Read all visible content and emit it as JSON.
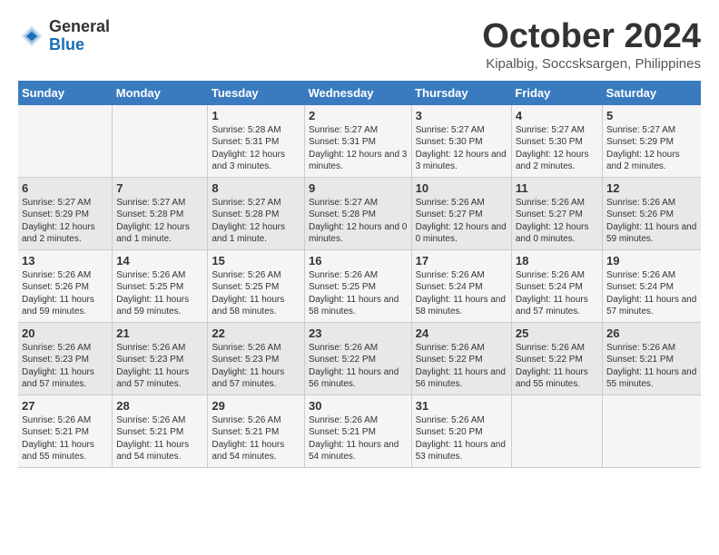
{
  "header": {
    "logo_line1": "General",
    "logo_line2": "Blue",
    "month_title": "October 2024",
    "location": "Kipalbig, Soccsksargen, Philippines"
  },
  "days_of_week": [
    "Sunday",
    "Monday",
    "Tuesday",
    "Wednesday",
    "Thursday",
    "Friday",
    "Saturday"
  ],
  "weeks": [
    [
      {
        "day": "",
        "text": ""
      },
      {
        "day": "",
        "text": ""
      },
      {
        "day": "1",
        "text": "Sunrise: 5:28 AM\nSunset: 5:31 PM\nDaylight: 12 hours and 3 minutes."
      },
      {
        "day": "2",
        "text": "Sunrise: 5:27 AM\nSunset: 5:31 PM\nDaylight: 12 hours and 3 minutes."
      },
      {
        "day": "3",
        "text": "Sunrise: 5:27 AM\nSunset: 5:30 PM\nDaylight: 12 hours and 3 minutes."
      },
      {
        "day": "4",
        "text": "Sunrise: 5:27 AM\nSunset: 5:30 PM\nDaylight: 12 hours and 2 minutes."
      },
      {
        "day": "5",
        "text": "Sunrise: 5:27 AM\nSunset: 5:29 PM\nDaylight: 12 hours and 2 minutes."
      }
    ],
    [
      {
        "day": "6",
        "text": "Sunrise: 5:27 AM\nSunset: 5:29 PM\nDaylight: 12 hours and 2 minutes."
      },
      {
        "day": "7",
        "text": "Sunrise: 5:27 AM\nSunset: 5:28 PM\nDaylight: 12 hours and 1 minute."
      },
      {
        "day": "8",
        "text": "Sunrise: 5:27 AM\nSunset: 5:28 PM\nDaylight: 12 hours and 1 minute."
      },
      {
        "day": "9",
        "text": "Sunrise: 5:27 AM\nSunset: 5:28 PM\nDaylight: 12 hours and 0 minutes."
      },
      {
        "day": "10",
        "text": "Sunrise: 5:26 AM\nSunset: 5:27 PM\nDaylight: 12 hours and 0 minutes."
      },
      {
        "day": "11",
        "text": "Sunrise: 5:26 AM\nSunset: 5:27 PM\nDaylight: 12 hours and 0 minutes."
      },
      {
        "day": "12",
        "text": "Sunrise: 5:26 AM\nSunset: 5:26 PM\nDaylight: 11 hours and 59 minutes."
      }
    ],
    [
      {
        "day": "13",
        "text": "Sunrise: 5:26 AM\nSunset: 5:26 PM\nDaylight: 11 hours and 59 minutes."
      },
      {
        "day": "14",
        "text": "Sunrise: 5:26 AM\nSunset: 5:25 PM\nDaylight: 11 hours and 59 minutes."
      },
      {
        "day": "15",
        "text": "Sunrise: 5:26 AM\nSunset: 5:25 PM\nDaylight: 11 hours and 58 minutes."
      },
      {
        "day": "16",
        "text": "Sunrise: 5:26 AM\nSunset: 5:25 PM\nDaylight: 11 hours and 58 minutes."
      },
      {
        "day": "17",
        "text": "Sunrise: 5:26 AM\nSunset: 5:24 PM\nDaylight: 11 hours and 58 minutes."
      },
      {
        "day": "18",
        "text": "Sunrise: 5:26 AM\nSunset: 5:24 PM\nDaylight: 11 hours and 57 minutes."
      },
      {
        "day": "19",
        "text": "Sunrise: 5:26 AM\nSunset: 5:24 PM\nDaylight: 11 hours and 57 minutes."
      }
    ],
    [
      {
        "day": "20",
        "text": "Sunrise: 5:26 AM\nSunset: 5:23 PM\nDaylight: 11 hours and 57 minutes."
      },
      {
        "day": "21",
        "text": "Sunrise: 5:26 AM\nSunset: 5:23 PM\nDaylight: 11 hours and 57 minutes."
      },
      {
        "day": "22",
        "text": "Sunrise: 5:26 AM\nSunset: 5:23 PM\nDaylight: 11 hours and 57 minutes."
      },
      {
        "day": "23",
        "text": "Sunrise: 5:26 AM\nSunset: 5:22 PM\nDaylight: 11 hours and 56 minutes."
      },
      {
        "day": "24",
        "text": "Sunrise: 5:26 AM\nSunset: 5:22 PM\nDaylight: 11 hours and 56 minutes."
      },
      {
        "day": "25",
        "text": "Sunrise: 5:26 AM\nSunset: 5:22 PM\nDaylight: 11 hours and 55 minutes."
      },
      {
        "day": "26",
        "text": "Sunrise: 5:26 AM\nSunset: 5:21 PM\nDaylight: 11 hours and 55 minutes."
      }
    ],
    [
      {
        "day": "27",
        "text": "Sunrise: 5:26 AM\nSunset: 5:21 PM\nDaylight: 11 hours and 55 minutes."
      },
      {
        "day": "28",
        "text": "Sunrise: 5:26 AM\nSunset: 5:21 PM\nDaylight: 11 hours and 54 minutes."
      },
      {
        "day": "29",
        "text": "Sunrise: 5:26 AM\nSunset: 5:21 PM\nDaylight: 11 hours and 54 minutes."
      },
      {
        "day": "30",
        "text": "Sunrise: 5:26 AM\nSunset: 5:21 PM\nDaylight: 11 hours and 54 minutes."
      },
      {
        "day": "31",
        "text": "Sunrise: 5:26 AM\nSunset: 5:20 PM\nDaylight: 11 hours and 53 minutes."
      },
      {
        "day": "",
        "text": ""
      },
      {
        "day": "",
        "text": ""
      }
    ]
  ]
}
